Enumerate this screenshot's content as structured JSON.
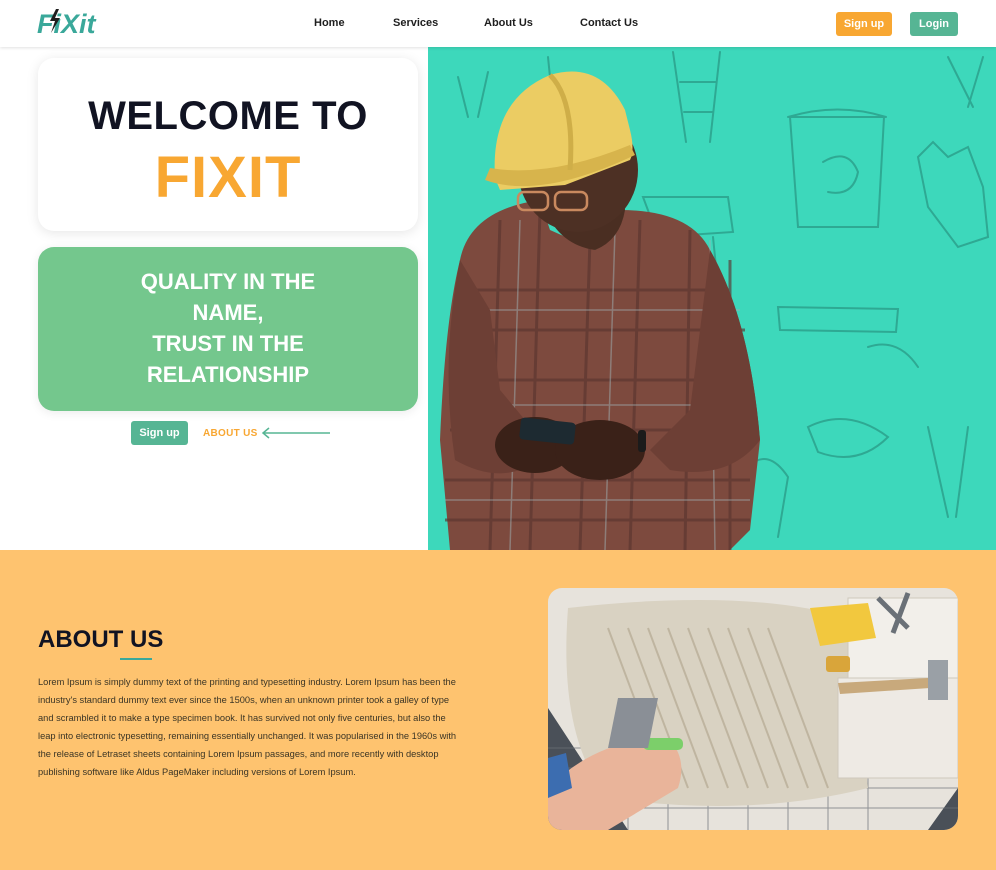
{
  "header": {
    "logo_text": "FiXit",
    "nav": [
      "Home",
      "Services",
      "About Us",
      "Contact Us"
    ],
    "signup_label": "Sign up",
    "login_label": "Login"
  },
  "hero": {
    "welcome": "WELCOME TO",
    "brand": "FIXIT",
    "tagline_lines": [
      "QUALITY IN THE",
      "NAME,",
      "TRUST IN THE",
      "RELATIONSHIP"
    ],
    "signup_label": "Sign up",
    "about_link": "ABOUT US"
  },
  "about": {
    "title": "ABOUT US",
    "body": "Lorem Ipsum is simply dummy text of the printing and typesetting industry. Lorem Ipsum has been the industry's standard dummy text ever since the 1500s, when an unknown printer took a galley of type and scrambled it to make a type specimen book. It has survived not only five centuries, but also the leap into electronic typesetting, remaining essentially unchanged. It was popularised in the 1960s with the release of Letraset sheets containing Lorem Ipsum passages, and more recently with desktop publishing software like Aldus PageMaker including versions of Lorem Ipsum."
  },
  "colors": {
    "accent_orange": "#f8a732",
    "accent_green": "#56b594",
    "hero_teal": "#3dd8bb",
    "tagline_green": "#74c78d",
    "about_bg": "#fec36f"
  }
}
